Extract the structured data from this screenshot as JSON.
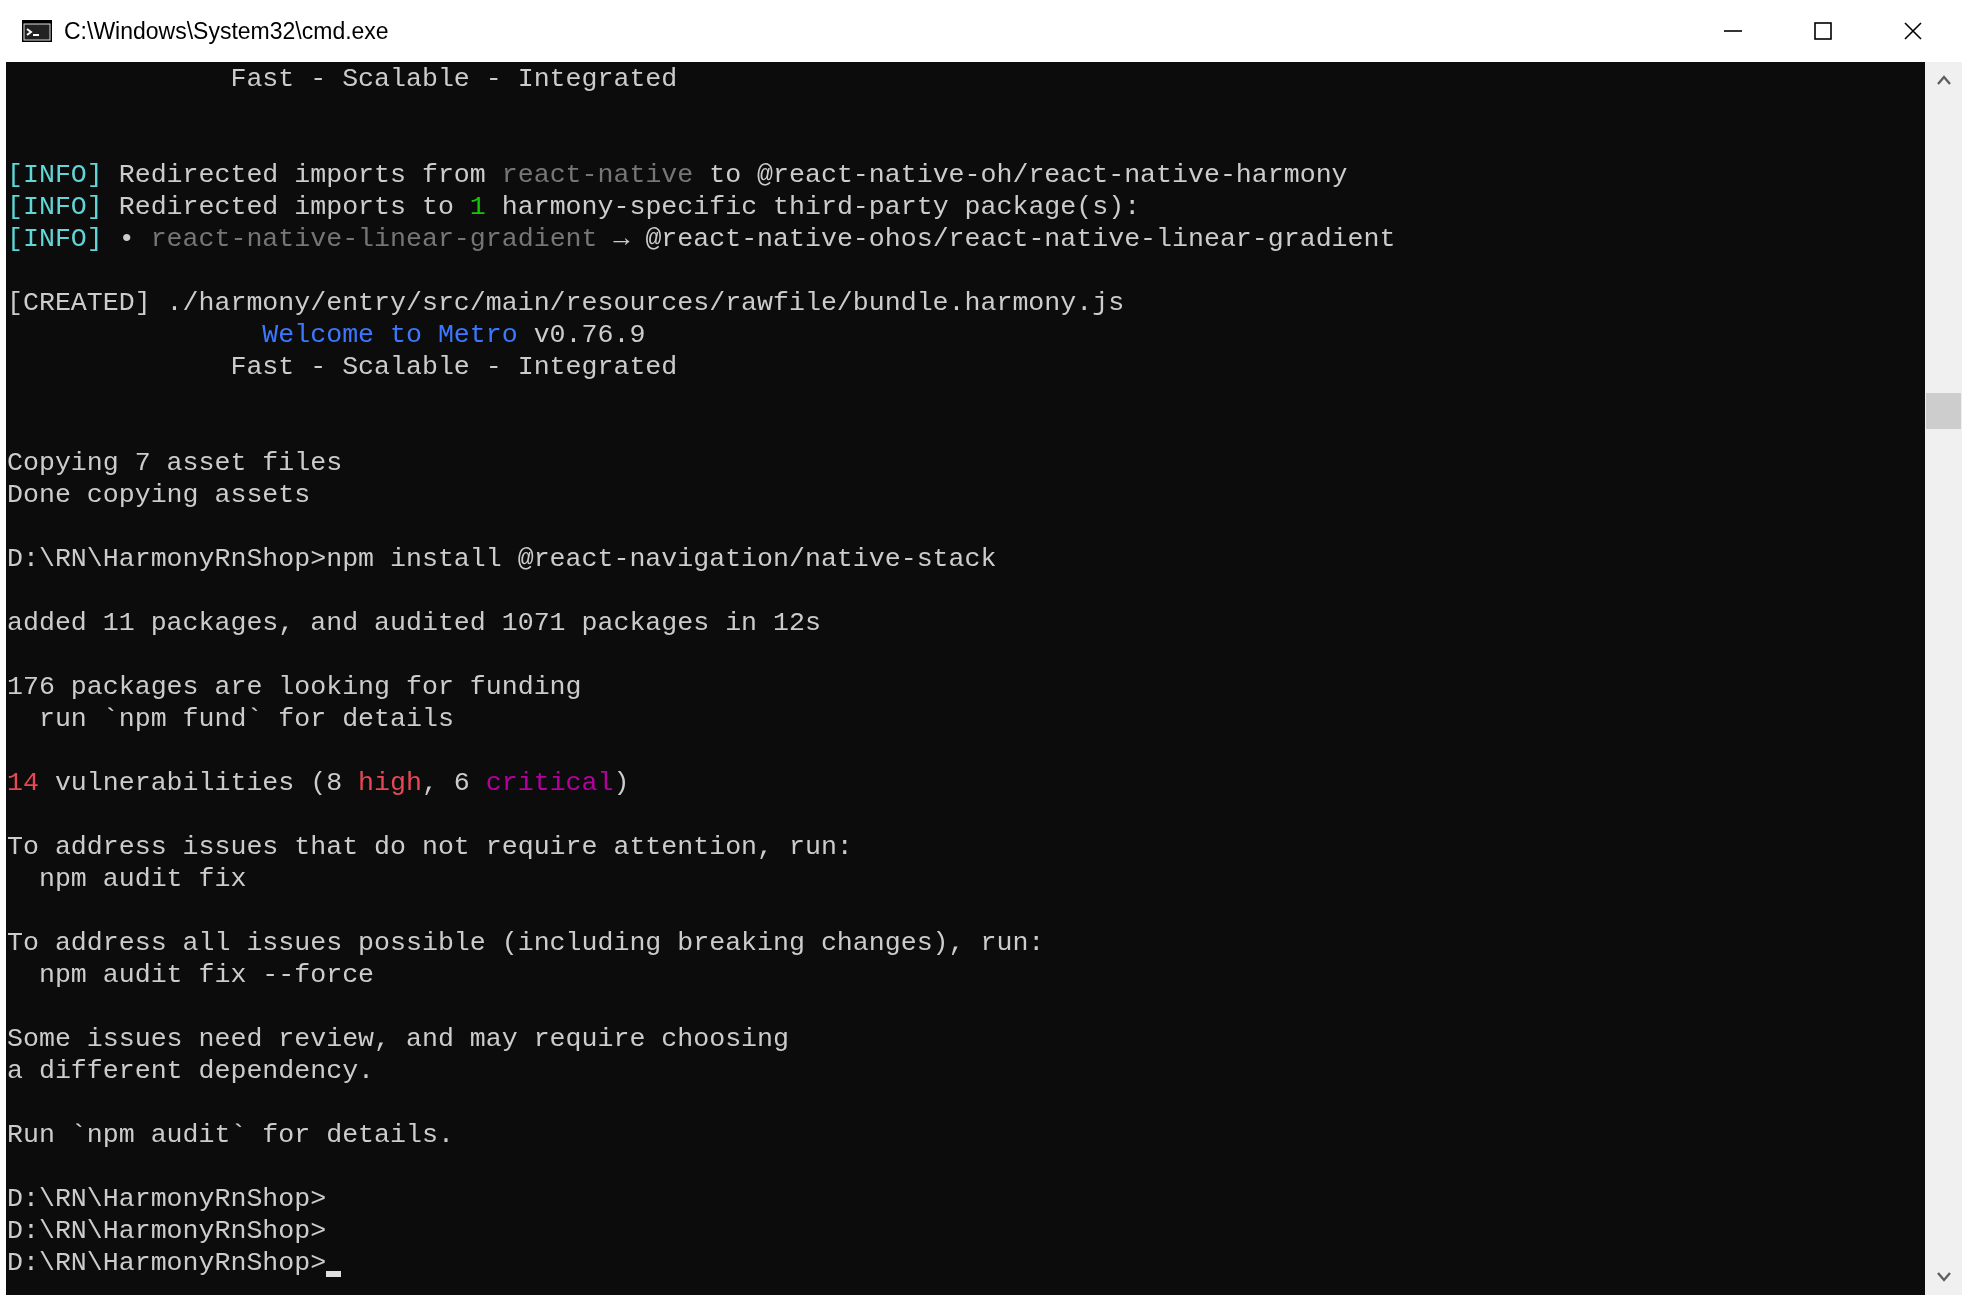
{
  "window": {
    "title": "C:\\Windows\\System32\\cmd.exe"
  },
  "console": {
    "lines": [
      {
        "kind": "text",
        "segments": [
          {
            "text": "              Fast - Scalable - Integrated",
            "color": "#cccccc"
          }
        ]
      },
      {
        "kind": "blank"
      },
      {
        "kind": "blank"
      },
      {
        "kind": "text",
        "segments": [
          {
            "text": "[INFO]",
            "color": "#61d6d6"
          },
          {
            "text": " Redirected imports from ",
            "color": "#cccccc"
          },
          {
            "text": "react-native",
            "color": "#767676"
          },
          {
            "text": " to @react-native-oh/react-native-harmony",
            "color": "#cccccc"
          }
        ]
      },
      {
        "kind": "text",
        "segments": [
          {
            "text": "[INFO]",
            "color": "#61d6d6"
          },
          {
            "text": " Redirected imports to ",
            "color": "#cccccc"
          },
          {
            "text": "1",
            "color": "#16c60c"
          },
          {
            "text": " harmony-specific third-party package(s):",
            "color": "#cccccc"
          }
        ]
      },
      {
        "kind": "text",
        "segments": [
          {
            "text": "[INFO]",
            "color": "#61d6d6"
          },
          {
            "text": " • ",
            "color": "#cccccc"
          },
          {
            "text": "react-native-linear-gradient",
            "color": "#767676"
          },
          {
            "text": " → @react-native-ohos/react-native-linear-gradient",
            "color": "#cccccc"
          }
        ]
      },
      {
        "kind": "blank"
      },
      {
        "kind": "text",
        "segments": [
          {
            "text": "[CREATED] ./harmony/entry/src/main/resources/rawfile/bundle.harmony.js",
            "color": "#cccccc"
          }
        ]
      },
      {
        "kind": "text",
        "segments": [
          {
            "text": "                Welcome to Metro",
            "color": "#3b78ff"
          },
          {
            "text": " v0.76.9",
            "color": "#cccccc"
          }
        ]
      },
      {
        "kind": "text",
        "segments": [
          {
            "text": "              Fast - Scalable - Integrated",
            "color": "#cccccc"
          }
        ]
      },
      {
        "kind": "blank"
      },
      {
        "kind": "blank"
      },
      {
        "kind": "text",
        "segments": [
          {
            "text": "Copying 7 asset files",
            "color": "#cccccc"
          }
        ]
      },
      {
        "kind": "text",
        "segments": [
          {
            "text": "Done copying assets",
            "color": "#cccccc"
          }
        ]
      },
      {
        "kind": "blank"
      },
      {
        "kind": "text",
        "segments": [
          {
            "text": "D:\\RN\\HarmonyRnShop>npm install @react-navigation/native-stack",
            "color": "#cccccc"
          }
        ]
      },
      {
        "kind": "blank"
      },
      {
        "kind": "text",
        "segments": [
          {
            "text": "added 11 packages, and audited 1071 packages in 12s",
            "color": "#cccccc"
          }
        ]
      },
      {
        "kind": "blank"
      },
      {
        "kind": "text",
        "segments": [
          {
            "text": "176 packages are looking for funding",
            "color": "#cccccc"
          }
        ]
      },
      {
        "kind": "text",
        "segments": [
          {
            "text": "  run `npm fund` for details",
            "color": "#cccccc"
          }
        ]
      },
      {
        "kind": "blank"
      },
      {
        "kind": "text",
        "segments": [
          {
            "text": "14",
            "color": "#e74856"
          },
          {
            "text": " vulnerabilities (8 ",
            "color": "#cccccc"
          },
          {
            "text": "high",
            "color": "#e74856"
          },
          {
            "text": ", 6 ",
            "color": "#cccccc"
          },
          {
            "text": "critical",
            "color": "#b4009e"
          },
          {
            "text": ")",
            "color": "#cccccc"
          }
        ]
      },
      {
        "kind": "blank"
      },
      {
        "kind": "text",
        "segments": [
          {
            "text": "To address issues that do not require attention, run:",
            "color": "#cccccc"
          }
        ]
      },
      {
        "kind": "text",
        "segments": [
          {
            "text": "  npm audit fix",
            "color": "#cccccc"
          }
        ]
      },
      {
        "kind": "blank"
      },
      {
        "kind": "text",
        "segments": [
          {
            "text": "To address all issues possible (including breaking changes), run:",
            "color": "#cccccc"
          }
        ]
      },
      {
        "kind": "text",
        "segments": [
          {
            "text": "  npm audit fix --force",
            "color": "#cccccc"
          }
        ]
      },
      {
        "kind": "blank"
      },
      {
        "kind": "text",
        "segments": [
          {
            "text": "Some issues need review, and may require choosing",
            "color": "#cccccc"
          }
        ]
      },
      {
        "kind": "text",
        "segments": [
          {
            "text": "a different dependency.",
            "color": "#cccccc"
          }
        ]
      },
      {
        "kind": "blank"
      },
      {
        "kind": "text",
        "segments": [
          {
            "text": "Run `npm audit` for details.",
            "color": "#cccccc"
          }
        ]
      },
      {
        "kind": "blank"
      },
      {
        "kind": "text",
        "segments": [
          {
            "text": "D:\\RN\\HarmonyRnShop>",
            "color": "#cccccc"
          }
        ]
      },
      {
        "kind": "text",
        "segments": [
          {
            "text": "D:\\RN\\HarmonyRnShop>",
            "color": "#cccccc"
          }
        ]
      },
      {
        "kind": "text",
        "cursor": true,
        "segments": [
          {
            "text": "D:\\RN\\HarmonyRnShop>",
            "color": "#cccccc"
          }
        ]
      }
    ]
  }
}
